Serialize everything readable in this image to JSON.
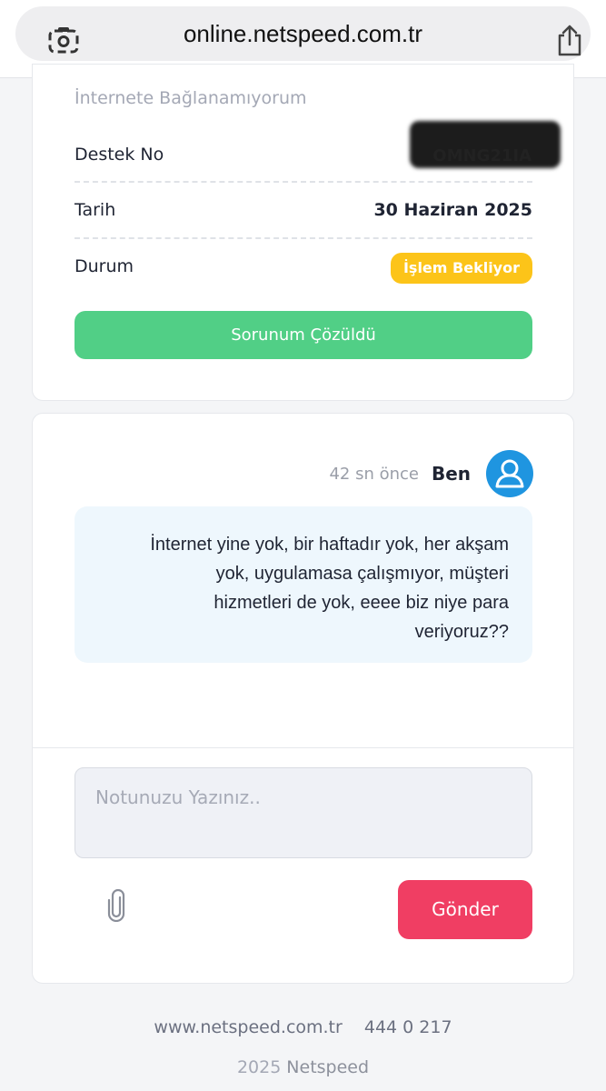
{
  "browser": {
    "url": "online.netspeed.com.tr",
    "lens_icon": "camera-lens-icon",
    "share_icon": "share-icon"
  },
  "ticket": {
    "subject": "İnternete Bağlanamıyorum",
    "support_no_label": "Destek No",
    "support_no_value": "OMNG21IA",
    "date_label": "Tarih",
    "date_value": "30 Haziran 2025",
    "status_label": "Durum",
    "status_value": "İşlem Bekliyor",
    "status_color": "#fcc419",
    "resolved_button": "Sorunum Çözüldü",
    "resolved_color": "#51cf86"
  },
  "chat": {
    "time": "42 sn önce",
    "author": "Ben",
    "message_lines": [
      "İnternet yine yok, bir haftadır yok, her akşam",
      "yok, uygulamasa çalışmıyor, müşteri",
      "hizmetleri de yok, eeee biz niye para",
      "veriyoruz??"
    ],
    "note_placeholder": "Notunuzu Yazınız..",
    "note_value": "",
    "send_button": "Gönder",
    "send_color": "#f03e63"
  },
  "footer": {
    "website": "www.netspeed.com.tr",
    "phone": "444 0 217",
    "year": "2025",
    "brand": "Netspeed"
  }
}
